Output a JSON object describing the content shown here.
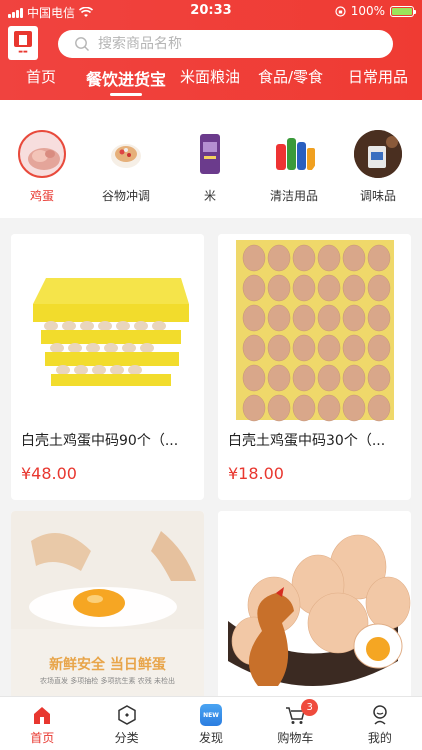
{
  "status_bar": {
    "carrier": "中国电信",
    "time": "20:33",
    "battery": "100%"
  },
  "search": {
    "placeholder": "搜索商品名称"
  },
  "tabs": [
    {
      "label": "首页"
    },
    {
      "label": "餐饮进货宝"
    },
    {
      "label": "米面粮油"
    },
    {
      "label": "食品/零食"
    },
    {
      "label": "日常用品"
    }
  ],
  "categories": [
    {
      "label": "鸡蛋"
    },
    {
      "label": "谷物冲调"
    },
    {
      "label": "米"
    },
    {
      "label": "清洁用品"
    },
    {
      "label": "调味品"
    }
  ],
  "products": [
    {
      "name": "白壳土鸡蛋中码90个（...",
      "price": "¥48.00"
    },
    {
      "name": "白壳土鸡蛋中码30个（...",
      "price": "¥18.00"
    },
    {
      "name": "",
      "price": "",
      "banner": "新鲜安全  当日鲜蛋",
      "banner_sub": "农场直发  多项抽检  多项抗生素  农残 未检出"
    },
    {
      "name": "",
      "price": ""
    }
  ],
  "bottom_nav": [
    {
      "label": "首页",
      "icon": "home-icon"
    },
    {
      "label": "分类",
      "icon": "category-icon"
    },
    {
      "label": "发现",
      "icon": "discover-icon",
      "icon_text": "NEW"
    },
    {
      "label": "购物车",
      "icon": "cart-icon",
      "badge": "3"
    },
    {
      "label": "我的",
      "icon": "profile-icon"
    }
  ],
  "colors": {
    "accent": "#e8372f",
    "header": "#f0433f"
  }
}
